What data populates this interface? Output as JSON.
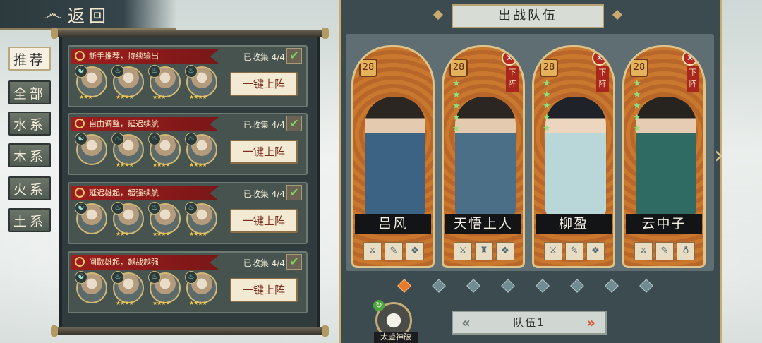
{
  "back_label": "返回",
  "tabs": [
    "推荐",
    "全部",
    "水系",
    "木系",
    "火系",
    "土系"
  ],
  "teams": [
    {
      "title": "新手推荐，持续输出",
      "collected": "已收集 4/4",
      "button": "一键上阵",
      "stars": [
        "★★★",
        "★★★★",
        "★★★",
        "★★★★"
      ]
    },
    {
      "title": "自由调整，延迟续航",
      "collected": "已收集 4/4",
      "button": "一键上阵",
      "stars": [
        "",
        "★★★★",
        "★★★★",
        "★★★★"
      ]
    },
    {
      "title": "延迟雄起，超强续航",
      "collected": "已收集 4/4",
      "button": "一键上阵",
      "stars": [
        "",
        "★★★",
        "★★★★",
        "★★★★"
      ]
    },
    {
      "title": "间歇雄起，越战越强",
      "collected": "已收集 4/4",
      "button": "一键上阵",
      "stars": [
        "",
        "★★★★",
        "★★★★",
        "★★★★"
      ]
    }
  ],
  "panel_title": "出战队伍",
  "cards": [
    {
      "name": "吕风",
      "level": "28",
      "stars": 0,
      "removable": false
    },
    {
      "name": "天悟上人",
      "level": "28",
      "stars": 5,
      "removable": true
    },
    {
      "name": "柳盈",
      "level": "28",
      "stars": 5,
      "removable": true
    },
    {
      "name": "云中子",
      "level": "28",
      "stars": 5,
      "removable": true
    }
  ],
  "remove_label": "下阵",
  "page_dots": 8,
  "active_dot": 0,
  "skill_label": "太虚神破",
  "team_selector": "队伍1",
  "colors": {
    "ribbon": "#9e1e1e",
    "accent": "#c8a970",
    "active_dot": "#e8792b"
  }
}
